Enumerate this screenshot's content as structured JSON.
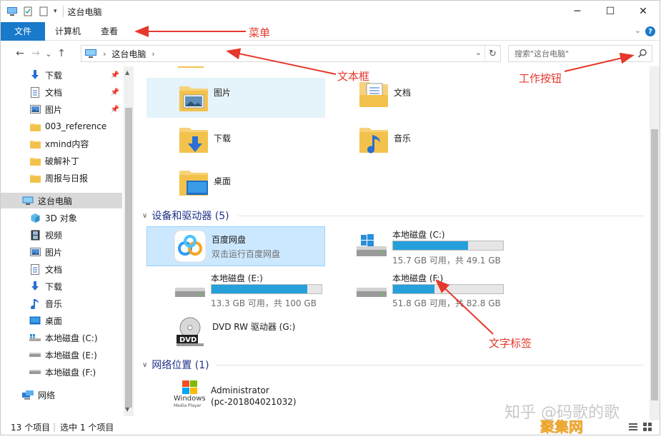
{
  "window": {
    "title": "这台电脑",
    "controls": {
      "minimize": "─",
      "maximize": "☐",
      "close": "✕"
    }
  },
  "ribbon": {
    "tabs": [
      "文件",
      "计算机",
      "查看"
    ],
    "help": "?"
  },
  "nav": {
    "back": "←",
    "forward": "→",
    "recent": "⌄",
    "up": "↑",
    "breadcrumb": "这台电脑",
    "search_placeholder": "搜索\"这台电脑\""
  },
  "sidebar": {
    "quick": [
      {
        "label": "下载",
        "icon": "download-icon",
        "pinned": true
      },
      {
        "label": "文档",
        "icon": "document-icon",
        "pinned": true
      },
      {
        "label": "图片",
        "icon": "picture-icon",
        "pinned": true
      },
      {
        "label": "003_reference",
        "icon": "folder-icon",
        "pinned": false
      },
      {
        "label": "xmind内容",
        "icon": "folder-icon",
        "pinned": false
      },
      {
        "label": "破解补丁",
        "icon": "folder-icon",
        "pinned": false
      },
      {
        "label": "周报与日报",
        "icon": "folder-icon",
        "pinned": false
      }
    ],
    "this_pc": "这台电脑",
    "pc_items": [
      {
        "label": "3D 对象",
        "icon": "3d-objects-icon"
      },
      {
        "label": "视频",
        "icon": "video-icon"
      },
      {
        "label": "图片",
        "icon": "picture-icon"
      },
      {
        "label": "文档",
        "icon": "document-icon"
      },
      {
        "label": "下载",
        "icon": "download-icon"
      },
      {
        "label": "音乐",
        "icon": "music-icon"
      },
      {
        "label": "桌面",
        "icon": "desktop-icon"
      },
      {
        "label": "本地磁盘 (C:)",
        "icon": "windows-drive-icon"
      },
      {
        "label": "本地磁盘 (E:)",
        "icon": "drive-icon"
      },
      {
        "label": "本地磁盘 (F:)",
        "icon": "drive-icon"
      }
    ],
    "network": "网络"
  },
  "folders": [
    "图片",
    "文档",
    "下载",
    "音乐",
    "桌面"
  ],
  "devices_group": "设备和驱动器 (5)",
  "baidu": {
    "name": "百度网盘",
    "desc": "双击运行百度网盘"
  },
  "drives": [
    {
      "name": "本地磁盘 (C:)",
      "free": "15.7 GB 可用，共 49.1 GB",
      "used_fraction": 0.68
    },
    {
      "name": "本地磁盘 (E:)",
      "free": "13.3 GB 可用，共 100 GB",
      "used_fraction": 0.867
    },
    {
      "name": "本地磁盘 (F:)",
      "free": "51.8 GB 可用，共 82.8 GB",
      "used_fraction": 0.374
    }
  ],
  "dvd": {
    "name": "DVD RW 驱动器 (G:)",
    "badge": "DVD"
  },
  "network_group": "网络位置 (1)",
  "network_item": {
    "name": "Administrator",
    "sub": "(pc-201804021032)",
    "logo_line1": "Windows",
    "logo_line2": "Media Player"
  },
  "status": {
    "count": "13 个项目",
    "selected": "选中 1 个项目"
  },
  "annotations": {
    "menu": "菜单",
    "textbox": "文本框",
    "work_button": "工作按钮",
    "text_label": "文字标签"
  },
  "watermark": {
    "line1": "知乎 @码歌的歌",
    "line2": "聚集网"
  },
  "colors": {
    "accent": "#1979ca",
    "annotation": "#e6382c",
    "drive_fill": "#26a0da"
  }
}
